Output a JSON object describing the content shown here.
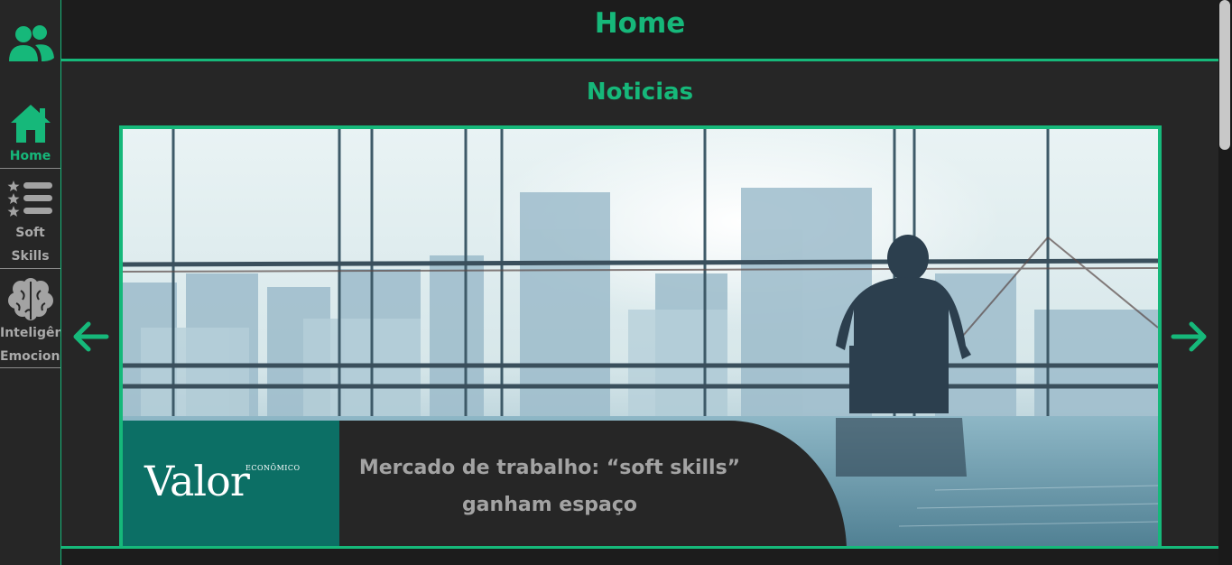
{
  "header": {
    "title": "Home"
  },
  "sidebar": {
    "logo_icon": "users-icon",
    "items": [
      {
        "label": "Home",
        "icon": "home-icon",
        "active": true
      },
      {
        "label": "Soft Skills",
        "label_lines": [
          "Soft",
          "Skills"
        ],
        "icon": "star-list-icon",
        "active": false
      },
      {
        "label": "Inteligência Emocional",
        "label_lines": [
          "Inteligência",
          "Emocional"
        ],
        "icon": "brain-icon",
        "active": false
      }
    ]
  },
  "main": {
    "section_title": "Noticias",
    "carousel": {
      "prev_icon": "arrow-left-icon",
      "next_icon": "arrow-right-icon",
      "slide": {
        "brand_name": "Valor",
        "brand_sub": "ECONÔMICO",
        "headline_line1": "Mercado de trabalho: “soft skills”",
        "headline_line2": "ganham espaço"
      }
    }
  },
  "colors": {
    "accent": "#16b87a",
    "background": "#1c1c1c",
    "panel": "#262626",
    "brand": "#0c6f65",
    "muted_text": "#a3a3a3"
  }
}
